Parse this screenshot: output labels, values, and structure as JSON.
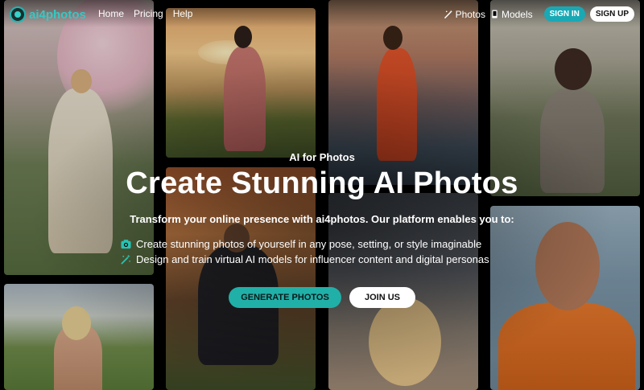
{
  "nav": {
    "logo_text": "ai4photos",
    "links": [
      "Home",
      "Pricing",
      "Help"
    ],
    "photos_label": "Photos",
    "models_label": "Models",
    "signin_label": "SIGN IN",
    "signup_label": "SIGN UP"
  },
  "hero": {
    "eyebrow": "AI for Photos",
    "headline": "Create Stunning AI Photos",
    "subhead": "Transform your online presence with ai4photos. Our platform enables you to:",
    "bullets": [
      {
        "icon": "camera-icon",
        "text": "Create stunning photos of yourself in any pose, setting, or style imaginable"
      },
      {
        "icon": "magic-wand-icon",
        "text": "Design and train virtual AI models for influencer content and digital personas"
      }
    ],
    "primary_cta": "GENERATE PHOTOS",
    "secondary_cta": "JOIN US"
  },
  "colors": {
    "accent": "#1fb6b2",
    "cta_primary": "#20b0a8",
    "signin_bg": "#19a9b5"
  }
}
